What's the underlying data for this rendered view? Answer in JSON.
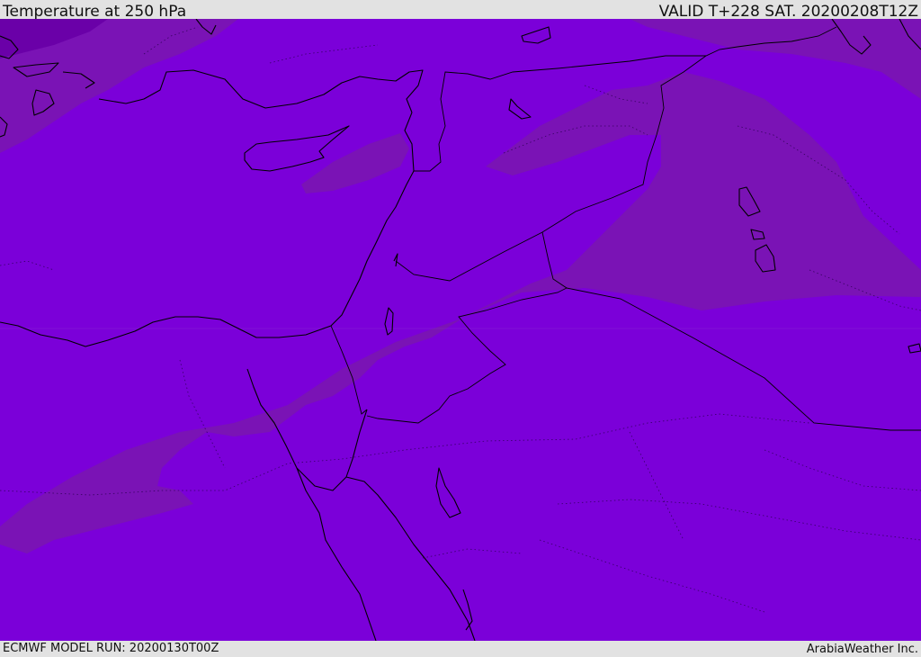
{
  "header": {
    "title": "Temperature at 250 hPa",
    "valid": "VALID T+228 SAT. 20200208T12Z"
  },
  "footer": {
    "model_run": "ECMWF MODEL RUN: 20200130T00Z",
    "credit": "ArabiaWeather Inc."
  },
  "colors": {
    "field_main": "#7b00d9",
    "field_band": "#7a13b5",
    "field_dark": "#6a00a8",
    "coastline": "#000000",
    "bar_background": "#e2e2e2"
  }
}
